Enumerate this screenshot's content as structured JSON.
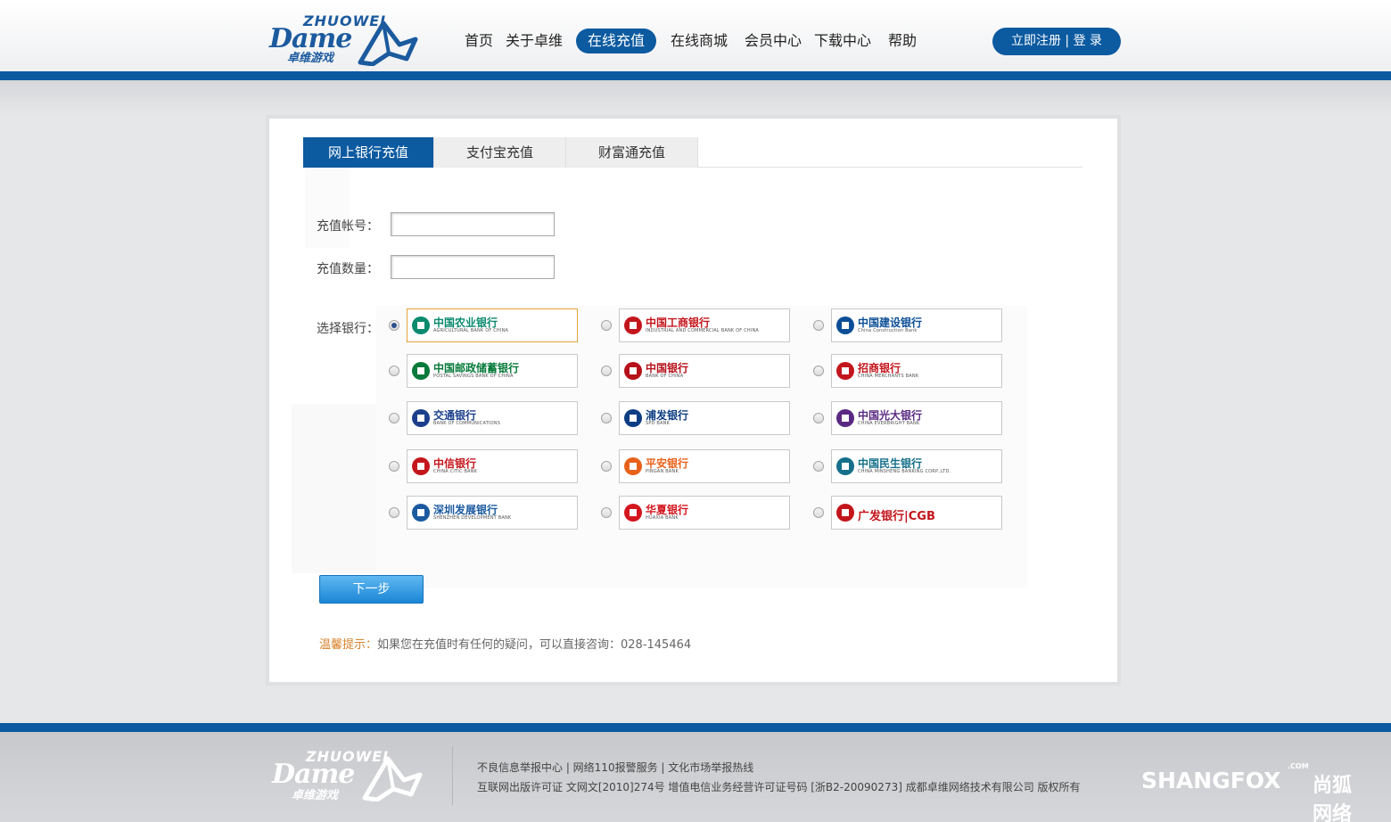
{
  "logo": {
    "wordmark_top": "ZHUOWEI",
    "wordmark_main": "Dame",
    "wordmark_cn": "卓维游戏"
  },
  "nav": {
    "items": [
      {
        "label": "首页"
      },
      {
        "label": "关于卓维"
      },
      {
        "label": "在线充值",
        "active": true
      },
      {
        "label": "在线商城"
      },
      {
        "label": "会员中心"
      },
      {
        "label": "下载中心"
      },
      {
        "label": "帮助"
      }
    ]
  },
  "auth": {
    "register": "立即注册",
    "separator": "|",
    "login": "登 录"
  },
  "tabs": [
    {
      "label": "网上银行充值",
      "active": true
    },
    {
      "label": "支付宝充值"
    },
    {
      "label": "财富通充值"
    }
  ],
  "form": {
    "account_label": "充值帐号：",
    "account_value": "",
    "amount_label": "充值数量：",
    "amount_value": "",
    "bank_label": "选择银行："
  },
  "banks": [
    {
      "name": "中国农业银行",
      "sub": "AGRICULTURAL BANK OF CHINA",
      "color": "#0a8a6e",
      "selected": true
    },
    {
      "name": "中国工商银行",
      "sub": "INDUSTRIAL AND COMMERCIAL BANK OF CHINA",
      "color": "#c3161c"
    },
    {
      "name": "中国建设银行",
      "sub": "China Construction Bank",
      "color": "#0b4e96"
    },
    {
      "name": "中国邮政储蓄银行",
      "sub": "POSTAL SAVINGS BANK OF CHINA",
      "color": "#067a3a"
    },
    {
      "name": "中国银行",
      "sub": "BANK OF CHINA",
      "color": "#b6111a"
    },
    {
      "name": "招商银行",
      "sub": "CHINA MERCHANTS BANK",
      "color": "#c3161c"
    },
    {
      "name": "交通银行",
      "sub": "BANK OF COMMUNICATIONS",
      "color": "#1c3f8c"
    },
    {
      "name": "浦发银行",
      "sub": "SPD BANK",
      "color": "#0d3d83"
    },
    {
      "name": "中国光大银行",
      "sub": "CHINA EVERBRIGHT BANK",
      "color": "#5a2a82"
    },
    {
      "name": "中信银行",
      "sub": "CHINA CITIC BANK",
      "color": "#c3161c"
    },
    {
      "name": "平安银行",
      "sub": "PINGAN BANK",
      "color": "#e8611a"
    },
    {
      "name": "中国民生银行",
      "sub": "CHINA MINSHENG BANKING CORP.,LTD.",
      "color": "#156f8a"
    },
    {
      "name": "深圳发展银行",
      "sub": "SHENZHEN DEVELOPMENT BANK",
      "color": "#1b5aa0"
    },
    {
      "name": "华夏银行",
      "sub": "HUAXIA BANK",
      "color": "#d3161e"
    },
    {
      "name": "广发银行|CGB",
      "sub": "",
      "color": "#c3161c"
    }
  ],
  "actions": {
    "next": "下一步"
  },
  "tip": {
    "label": "温馨提示：",
    "text": "如果您在充值时有任何的疑问，可以直接咨询：028-145464"
  },
  "footer": {
    "line1": "不良信息举报中心 | 网络110报警服务 | 文化市场举报热线",
    "line2": "互联网出版许可证 文网文[2010]274号 增值电信业务经营许可证号码 [浙B2-20090273] 成都卓维网络技术有限公司 版权所有",
    "brand": "SHANGFOX",
    "brand_cn": "尚狐网络",
    "brand_com": ".COM"
  },
  "colors": {
    "brand_blue": "#0c5aa0",
    "tip_orange": "#d9822b",
    "selected_border": "#e6a33c"
  }
}
